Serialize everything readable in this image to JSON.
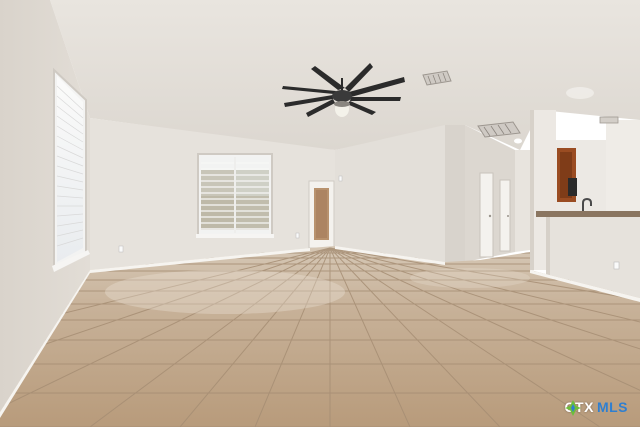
{
  "photo": {
    "subject": "",
    "elements": [
      "ceiling-fan",
      "window-left-wall",
      "window-back-wall",
      "exterior-door",
      "interior-doors",
      "kitchen-counter",
      "ceiling-vents",
      "ceiling-light",
      "tile-floor"
    ]
  },
  "watermark": {
    "part1": "CTX",
    "part2": "MLS",
    "mark_color": "#6cbf3a",
    "accent_color": "#2f7fd0"
  },
  "colors": {
    "wall": "#e4e0da",
    "wall_shadow": "#cfc9c1",
    "ceiling": "#ebe7e2",
    "floor": "#c2ab90",
    "grout": "#a68e74",
    "trim": "#f4f2ee",
    "fan_blade": "#2b2b2b",
    "cabinet": "#9a4c22"
  }
}
